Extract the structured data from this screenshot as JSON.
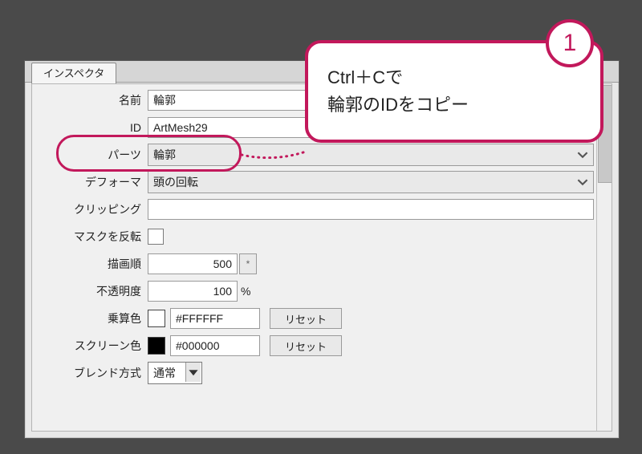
{
  "tab": {
    "label": "インスペクタ"
  },
  "fields": {
    "name": {
      "label": "名前",
      "value": "輪郭"
    },
    "id": {
      "label": "ID",
      "value": "ArtMesh29"
    },
    "parts": {
      "label": "パーツ",
      "value": "輪郭"
    },
    "deformer": {
      "label": "デフォーマ",
      "value": "頭の回転"
    },
    "clipping": {
      "label": "クリッピング",
      "value": ""
    },
    "invertMask": {
      "label": "マスクを反転"
    },
    "drawOrder": {
      "label": "描画順",
      "value": "500",
      "sideBtn": "*"
    },
    "opacity": {
      "label": "不透明度",
      "value": "100",
      "unit": "%"
    },
    "multiply": {
      "label": "乗算色",
      "hex": "#FFFFFF",
      "swatch": "#FFFFFF",
      "reset": "リセット"
    },
    "screen": {
      "label": "スクリーン色",
      "hex": "#000000",
      "swatch": "#000000",
      "reset": "リセット"
    },
    "blend": {
      "label": "ブレンド方式",
      "value": "通常"
    }
  },
  "annotation": {
    "badge": "1",
    "lines": [
      "Ctrl＋Cで",
      "輪郭のIDをコピー"
    ]
  },
  "colors": {
    "accent": "#c2185b"
  }
}
